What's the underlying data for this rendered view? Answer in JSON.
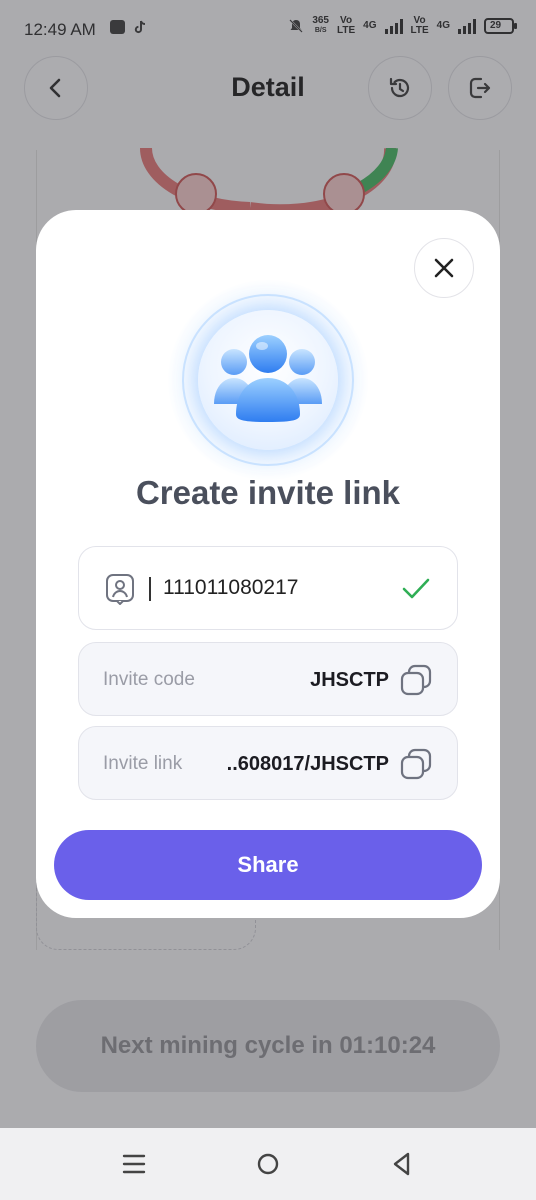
{
  "status_bar": {
    "time": "12:49 AM",
    "net_speed_value": "365",
    "net_speed_unit": "B/S",
    "sim1_label_top": "Vo",
    "sim1_label_bottom": "LTE",
    "sim1_network": "4G",
    "sim2_label_top": "Vo",
    "sim2_label_bottom": "LTE",
    "sim2_network": "4G",
    "battery": "29"
  },
  "header": {
    "title": "Detail",
    "back_icon": "chevron-left-icon",
    "history_icon": "history-icon",
    "logout_icon": "logout-icon"
  },
  "background": {
    "mining_text": "Next mining cycle in 01:10:24"
  },
  "modal": {
    "title": "Create invite link",
    "close_icon": "close-icon",
    "hero_icon": "users-group-icon",
    "uid": {
      "icon": "user-badge-icon",
      "value": "111011080217",
      "status_icon": "check-icon"
    },
    "invite_code": {
      "label": "Invite code",
      "value": "JHSCTP",
      "copy_icon": "copy-icon"
    },
    "invite_link": {
      "label": "Invite link",
      "value": "..608017/JHSCTP",
      "copy_icon": "copy-icon"
    },
    "share_label": "Share"
  },
  "colors": {
    "accent": "#6a60ea",
    "check_green": "#2fae55",
    "title_gray": "#4a4f5c"
  },
  "nav_bar": {
    "menu_icon": "menu-icon",
    "home_icon": "home-circle-icon",
    "back_icon": "back-triangle-icon"
  }
}
